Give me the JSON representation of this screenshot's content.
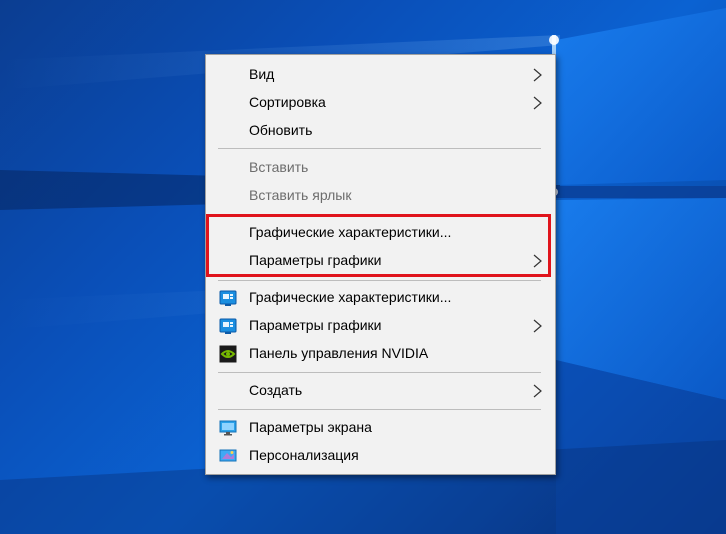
{
  "colors": {
    "menu_background": "#f2f2f2",
    "highlight_border": "#e0141c",
    "desktop_blue": "#0a55c4",
    "disabled_text": "#6d6d6d"
  },
  "context_menu": {
    "items": [
      {
        "label": "Вид",
        "has_submenu": true
      },
      {
        "label": "Сортировка",
        "has_submenu": true
      },
      {
        "label": "Обновить",
        "has_submenu": false
      },
      {
        "label": "Вставить",
        "has_submenu": false,
        "disabled": true
      },
      {
        "label": "Вставить ярлык",
        "has_submenu": false,
        "disabled": true
      },
      {
        "label": "Графические характеристики...",
        "has_submenu": false
      },
      {
        "label": "Параметры графики",
        "has_submenu": true
      },
      {
        "label": "Графические характеристики...",
        "has_submenu": false,
        "icon": "intel-graphics-icon"
      },
      {
        "label": "Параметры графики",
        "has_submenu": true,
        "icon": "intel-graphics-icon"
      },
      {
        "label": "Панель управления NVIDIA",
        "has_submenu": false,
        "icon": "nvidia-icon"
      },
      {
        "label": "Создать",
        "has_submenu": true
      },
      {
        "label": "Параметры экрана",
        "has_submenu": false,
        "icon": "display-icon"
      },
      {
        "label": "Персонализация",
        "has_submenu": false,
        "icon": "personalization-icon"
      }
    ]
  }
}
